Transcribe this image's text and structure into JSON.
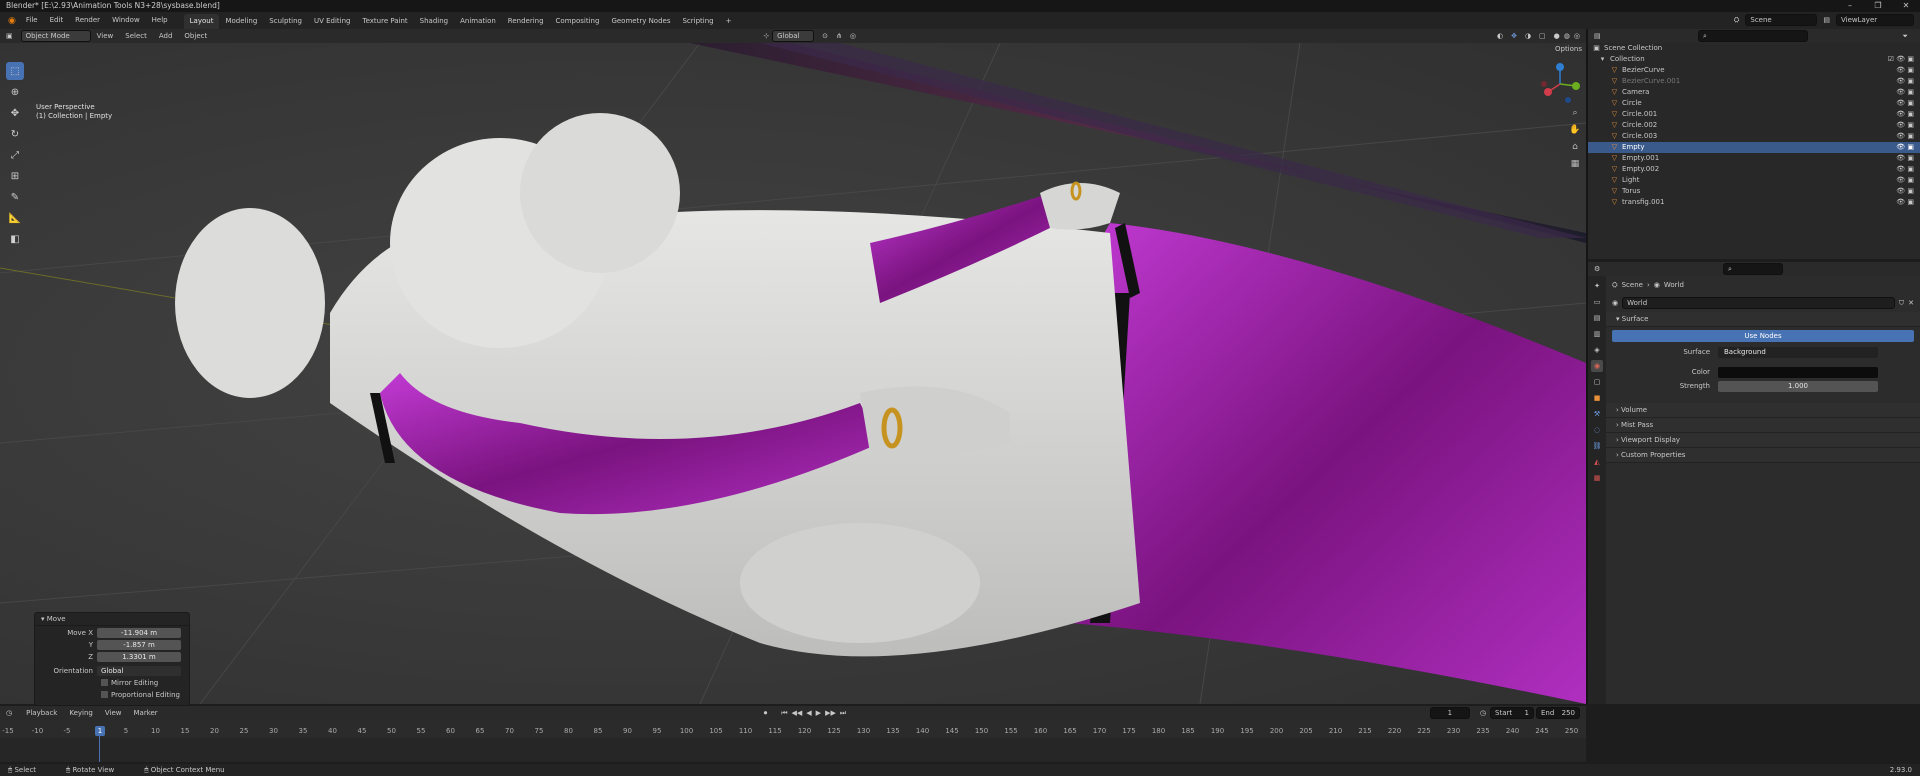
{
  "title": "Blender* [E:\\2.93\\Animation Tools N3+28\\sysbase.blend]",
  "window_controls": [
    "–",
    "❐",
    "✕"
  ],
  "menus": [
    "File",
    "Edit",
    "Render",
    "Window",
    "Help"
  ],
  "workspaces": [
    "Layout",
    "Modeling",
    "Sculpting",
    "UV Editing",
    "Texture Paint",
    "Shading",
    "Animation",
    "Rendering",
    "Compositing",
    "Geometry Nodes",
    "Scripting"
  ],
  "active_workspace": "Layout",
  "add_workspace": "+",
  "scene": "Scene",
  "view_layer": "ViewLayer",
  "viewport": {
    "mode": "Object Mode",
    "menus": [
      "View",
      "Select",
      "Add",
      "Object"
    ],
    "orientation": "Global",
    "options": "Options",
    "perspective": "User Perspective",
    "collection": "(1) Collection | Empty"
  },
  "move_panel": {
    "title": "Move",
    "move_x_label": "Move X",
    "move_x": "-11.904 m",
    "y_label": "Y",
    "y": "-1.857 m",
    "z_label": "Z",
    "z": "1.3301 m",
    "orientation_label": "Orientation",
    "orientation": "Global",
    "mirror": "Mirror Editing",
    "proportional": "Proportional Editing"
  },
  "outliner": {
    "root": "Scene Collection",
    "collection": "Collection",
    "items": [
      {
        "name": "BezierCurve",
        "dim": false
      },
      {
        "name": "BezierCurve.001",
        "dim": true
      },
      {
        "name": "Camera",
        "dim": false
      },
      {
        "name": "Circle",
        "dim": false
      },
      {
        "name": "Circle.001",
        "dim": false
      },
      {
        "name": "Circle.002",
        "dim": false
      },
      {
        "name": "Circle.003",
        "dim": false
      },
      {
        "name": "Empty",
        "dim": false,
        "selected": true
      },
      {
        "name": "Empty.001",
        "dim": false
      },
      {
        "name": "Empty.002",
        "dim": false
      },
      {
        "name": "Light",
        "dim": false
      },
      {
        "name": "Torus",
        "dim": false
      },
      {
        "name": "transfig.001",
        "dim": false
      }
    ]
  },
  "properties": {
    "breadcrumb_scene": "Scene",
    "breadcrumb_world": "World",
    "world_name": "World",
    "surface_section": "Surface",
    "use_nodes": "Use Nodes",
    "surface_label": "Surface",
    "surface_value": "Background",
    "color_label": "Color",
    "strength_label": "Strength",
    "strength_value": "1.000",
    "sections": [
      "Volume",
      "Mist Pass",
      "Viewport Display",
      "Custom Properties"
    ]
  },
  "timeline": {
    "menus": [
      "Playback",
      "Keying",
      "View",
      "Marker"
    ],
    "current_frame": "1",
    "start_label": "Start",
    "start": "1",
    "end_label": "End",
    "end": "250",
    "ticks": [
      "-15",
      "-10",
      "-5",
      "1",
      "5",
      "10",
      "15",
      "20",
      "25",
      "30",
      "35",
      "40",
      "45",
      "50",
      "55",
      "60",
      "65",
      "70",
      "75",
      "80",
      "85",
      "90",
      "95",
      "100",
      "105",
      "110",
      "115",
      "120",
      "125",
      "130",
      "135",
      "140",
      "145",
      "150",
      "155",
      "160",
      "165",
      "170",
      "175",
      "180",
      "185",
      "190",
      "195",
      "200",
      "205",
      "210",
      "215",
      "220",
      "225",
      "230",
      "235",
      "240",
      "245",
      "250"
    ]
  },
  "status": {
    "select": "Select",
    "rotate": "Rotate View",
    "context": "Object Context Menu",
    "version": "2.93.0"
  },
  "colors": {
    "accent": "#4772b3",
    "purple": "#9a1fa8",
    "skin": "#d8d8d6"
  }
}
